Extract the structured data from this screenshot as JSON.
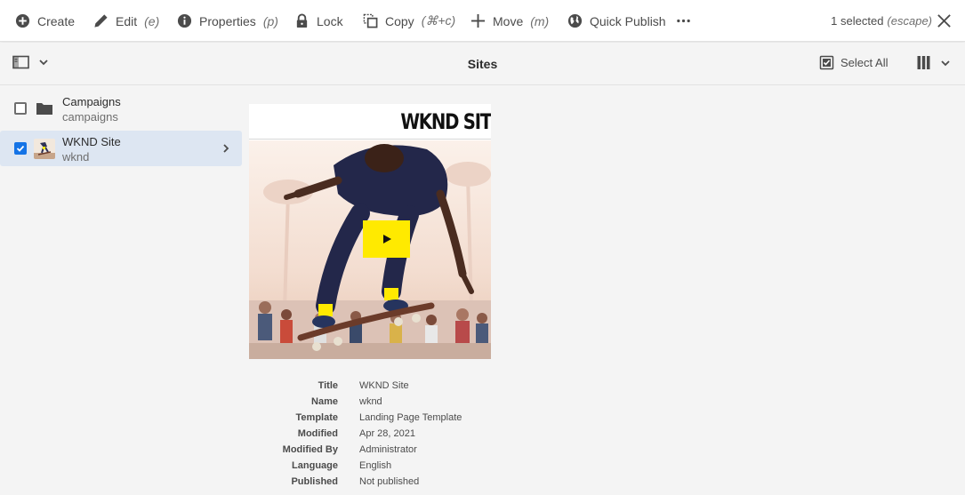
{
  "actionbar": {
    "create": {
      "label": "Create",
      "shortcut": ""
    },
    "edit": {
      "label": "Edit",
      "shortcut": "(e)"
    },
    "properties": {
      "label": "Properties",
      "shortcut": "(p)"
    },
    "lock": {
      "label": "Lock",
      "shortcut": ""
    },
    "copy": {
      "label": "Copy",
      "shortcut": "(⌘+c)"
    },
    "move": {
      "label": "Move",
      "shortcut": "(m)"
    },
    "quick_publish": {
      "label": "Quick Publish",
      "shortcut": ""
    },
    "selection_count": "1 selected",
    "selection_hint": "(escape)"
  },
  "titlebar": {
    "title": "Sites",
    "select_all": "Select All"
  },
  "column": {
    "items": [
      {
        "title": "Campaigns",
        "name": "campaigns",
        "icon": "folder-icon",
        "selected": false
      },
      {
        "title": "WKND Site",
        "name": "wknd",
        "icon": "site-thumbnail",
        "selected": true
      }
    ]
  },
  "preview": {
    "logo_text": "WKND SIT"
  },
  "meta": [
    {
      "key": "Title",
      "value": "WKND Site"
    },
    {
      "key": "Name",
      "value": "wknd"
    },
    {
      "key": "Template",
      "value": "Landing Page Template"
    },
    {
      "key": "Modified",
      "value": "Apr 28, 2021"
    },
    {
      "key": "Modified By",
      "value": "Administrator"
    },
    {
      "key": "Language",
      "value": "English"
    },
    {
      "key": "Published",
      "value": "Not published"
    }
  ],
  "colors": {
    "accent": "#1473e6",
    "selected_row": "#dde6f2",
    "play_button": "#ffea00"
  }
}
